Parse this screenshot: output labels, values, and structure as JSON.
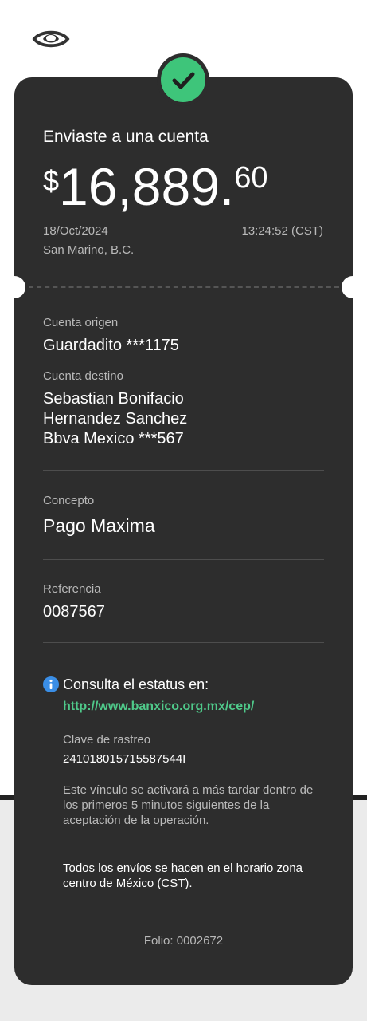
{
  "header": {
    "logo_icon": "eye-icon"
  },
  "status": {
    "icon": "check-icon",
    "color": "#3ec57a"
  },
  "transfer": {
    "title": "Enviaste a una cuenta",
    "currency_symbol": "$",
    "amount_integer": "16,889.",
    "amount_decimal": "60",
    "date": "18/Oct/2024",
    "time": "13:24:52 (CST)",
    "location": "San Marino, B.C."
  },
  "origin": {
    "label": "Cuenta origen",
    "value": "Guardadito ***1175"
  },
  "destination": {
    "label": "Cuenta destino",
    "line1": "Sebastian Bonifacio",
    "line2": "Hernandez Sanchez",
    "line3": "Bbva Mexico ***567"
  },
  "concept": {
    "label": "Concepto",
    "value": "Pago Maxima"
  },
  "reference": {
    "label": "Referencia",
    "value": "0087567"
  },
  "status_info": {
    "icon": "info-icon",
    "text": "Consulta el estatus en:",
    "link": "http://www.banxico.org.mx/cep/",
    "tracking_label": "Clave de rastreo",
    "tracking_value": "241018015715587544I",
    "note": "Este vínculo se activará a más tardar dentro de los primeros 5 minutos siguientes de la aceptación de la operación.",
    "schedule_note": "Todos los envíos se hacen en el horario zona centro de México (CST)."
  },
  "footer": {
    "folio": "Folio: 0002672"
  },
  "colors": {
    "card": "#2d2d2d",
    "accent_link": "#4fc98a",
    "info": "#3a8ee6"
  }
}
